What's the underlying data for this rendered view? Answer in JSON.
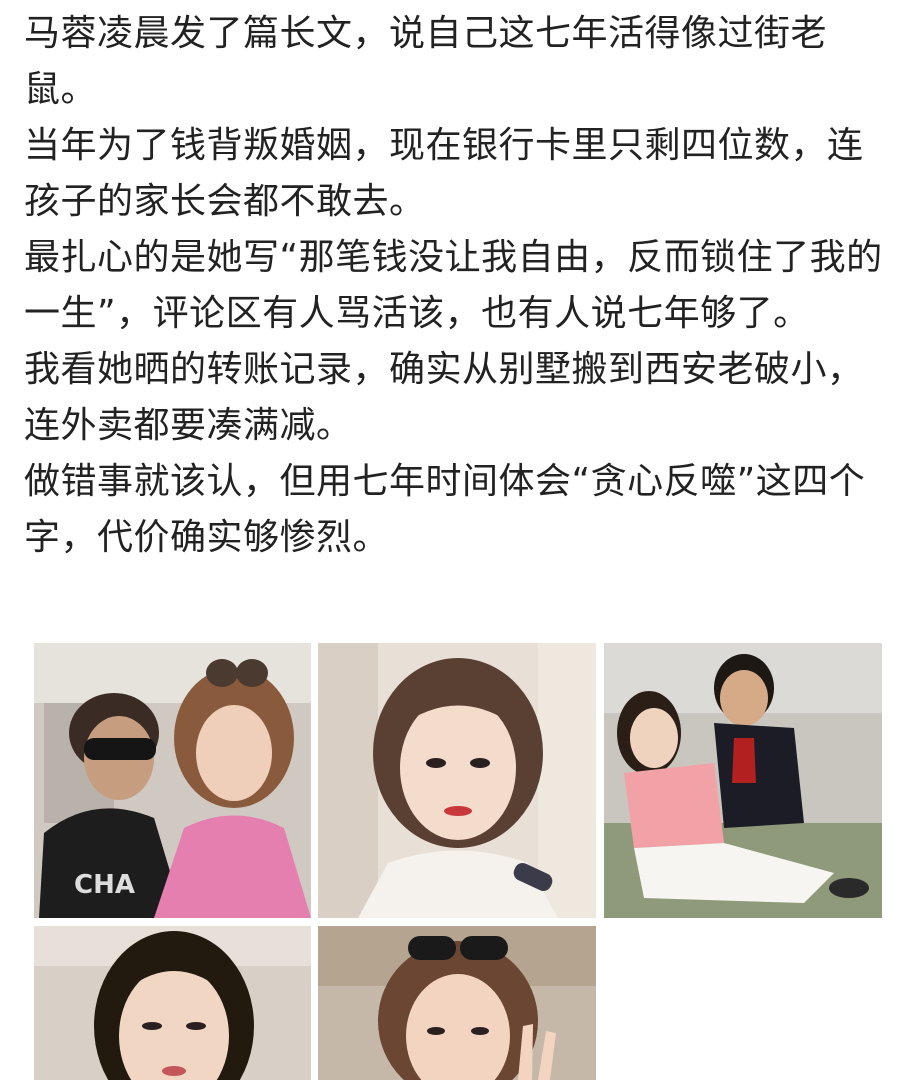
{
  "post": {
    "paragraphs": [
      "马蓉凌晨发了篇长文，说自己这七年活得像过街老鼠。",
      "当年为了钱背叛婚姻，现在银行卡里只剩四位数，连孩子的家长会都不敢去。",
      "最扎心的是她写“那笔钱没让我自由，反而锁住了我的一生”，评论区有人骂活该，也有人说七年够了。",
      "我看她晒的转账记录，确实从别墅搬到西安老破小，连外卖都要凑满减。",
      "做错事就该认，但用七年时间体会“贪心反噬”这四个字，代价确实够惨烈。"
    ]
  },
  "photos": [
    {
      "name": "photo-couple-selfie"
    },
    {
      "name": "photo-woman-portrait"
    },
    {
      "name": "photo-couple-hug"
    },
    {
      "name": "photo-woman-closeup"
    },
    {
      "name": "photo-woman-peace-sign"
    }
  ]
}
